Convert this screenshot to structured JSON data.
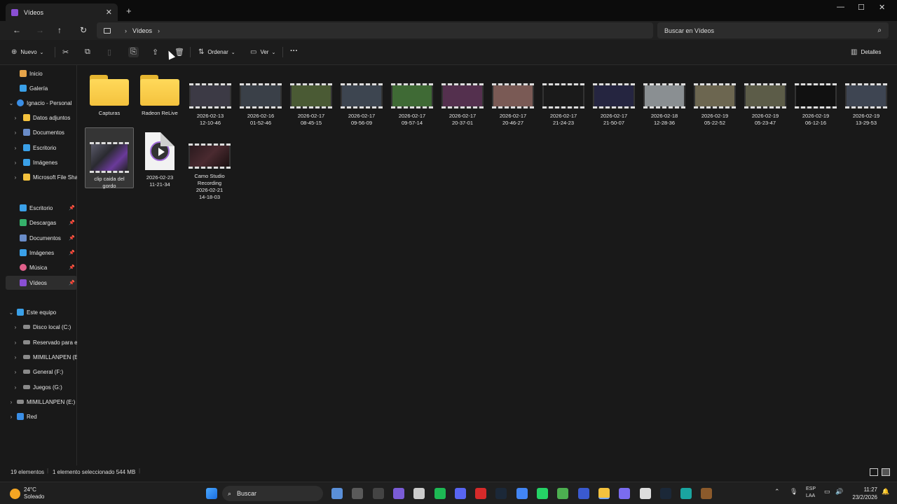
{
  "window": {
    "tab_title": "Vídeos",
    "controls": {
      "minimize": "—",
      "maximize": "☐",
      "close": "✕"
    }
  },
  "nav": {
    "breadcrumb": "Vídeos",
    "search_placeholder": "Buscar en Vídeos"
  },
  "command_bar": {
    "new_label": "Nuevo",
    "sort_label": "Ordenar",
    "view_label": "Ver",
    "more_label": "···",
    "details_label": "Detalles"
  },
  "sidebar": {
    "items": [
      {
        "label": "Inicio",
        "icon": "home-icon",
        "color": "#e7a54a"
      },
      {
        "label": "Galería",
        "icon": "gallery-icon",
        "color": "#3aa0e8"
      },
      {
        "label": "Ignacio - Personal",
        "icon": "cloud-icon",
        "color": "#3a8ee6"
      },
      {
        "label": "Datos adjuntos",
        "icon": "folder-icon",
        "color": "#f4c23d"
      },
      {
        "label": "Documentos",
        "icon": "documents-icon",
        "color": "#6a8cc8"
      },
      {
        "label": "Escritorio",
        "icon": "desktop-icon",
        "color": "#3aa0e8"
      },
      {
        "label": "Imágenes",
        "icon": "pictures-icon",
        "color": "#3aa0e8"
      },
      {
        "label": "Microsoft File Sha",
        "icon": "folder-icon",
        "color": "#f4c23d"
      }
    ],
    "pinned": [
      {
        "label": "Escritorio",
        "icon": "desktop-icon",
        "color": "#3aa0e8"
      },
      {
        "label": "Descargas",
        "icon": "downloads-icon",
        "color": "#35b06a"
      },
      {
        "label": "Documentos",
        "icon": "documents-icon",
        "color": "#6a8cc8"
      },
      {
        "label": "Imágenes",
        "icon": "pictures-icon",
        "color": "#3aa0e8"
      },
      {
        "label": "Música",
        "icon": "music-icon",
        "color": "#e0608a"
      },
      {
        "label": "Vídeos",
        "icon": "videos-icon",
        "color": "#8a4fd4"
      }
    ],
    "this_pc": {
      "label": "Este equipo",
      "icon": "computer-icon",
      "color": "#3aa0e8"
    },
    "drives": [
      {
        "label": "Disco local (C:)"
      },
      {
        "label": "Reservado para el"
      },
      {
        "label": "MIMILLANPEN (E:"
      },
      {
        "label": "General (F:)"
      },
      {
        "label": "Juegos (G:)"
      }
    ],
    "usb": {
      "label": "MIMILLANPEN (E:)"
    },
    "network": {
      "label": "Red"
    }
  },
  "files": {
    "folders": [
      {
        "name": "Capturas"
      },
      {
        "name": "Radeon ReLive"
      }
    ],
    "videos_row1": [
      {
        "date": "2026-02-13",
        "time": "12-10-46",
        "tone": "#3c3a45"
      },
      {
        "date": "2026-02-16",
        "time": "01-52-46",
        "tone": "#3a4048"
      },
      {
        "date": "2026-02-17",
        "time": "08-45-15",
        "tone": "#4a5a34"
      },
      {
        "date": "2026-02-17",
        "time": "09-56-09",
        "tone": "#3d4550"
      },
      {
        "date": "2026-02-17",
        "time": "09-57-14",
        "tone": "#3f6a35"
      },
      {
        "date": "2026-02-17",
        "time": "20-37-01",
        "tone": "#54304e"
      },
      {
        "date": "2026-02-17",
        "time": "20-46-27",
        "tone": "#7a5a55"
      },
      {
        "date": "2026-02-17",
        "time": "21-24-23",
        "tone": "#1a1a1a"
      },
      {
        "date": "2026-02-17",
        "time": "21-50-07",
        "tone": "#252540"
      },
      {
        "date": "2026-02-18",
        "time": "12-28-36",
        "tone": "#8a8f92"
      },
      {
        "date": "2026-02-19",
        "time": "05-22-52",
        "tone": "#6c6650"
      },
      {
        "date": "2026-02-19",
        "time": "05-23-47",
        "tone": "#5c5c48"
      },
      {
        "date": "2026-02-19",
        "time": "06-12-16",
        "tone": "#111111"
      },
      {
        "date": "2026-02-19",
        "time": "13-29-53",
        "tone": "#3e4552"
      }
    ],
    "row2": [
      {
        "line1": "clip caida del",
        "line2": "gordo"
      },
      {
        "line1": "2026-02-23",
        "line2": "11-21-34"
      },
      {
        "line1": "Camo Studio",
        "line2": "Recording",
        "line3": "2026-02-21",
        "line4": "14-18-03"
      }
    ]
  },
  "status": {
    "count": "19 elementos",
    "selected": "1 elemento seleccionado 544 MB"
  },
  "taskbar": {
    "temp": "24°C",
    "condition": "Soleado",
    "search_label": "Buscar",
    "lang1": "ESP",
    "lang2": "LAA",
    "time": "11:27",
    "date": "23/2/2026",
    "apps": [
      "start-icon",
      "explorer-app-icon",
      "files-app-icon",
      "epic-icon",
      "cortana-icon",
      "chatgpt-icon",
      "spotify-icon",
      "discord-icon",
      "opera-icon",
      "steam-icon",
      "chrome-icon",
      "whatsapp-icon",
      "minecraft-icon",
      "launcher-icon",
      "file-explorer-icon",
      "copilot-icon",
      "store-icon",
      "steam2-icon",
      "vpn-icon",
      "minecraft2-icon"
    ]
  }
}
